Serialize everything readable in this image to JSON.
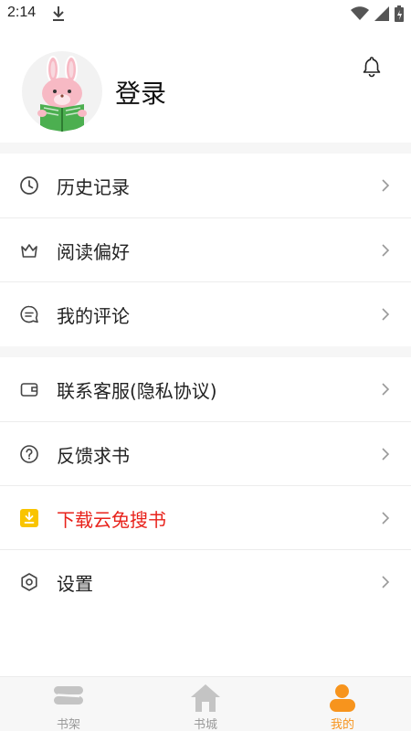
{
  "status_bar": {
    "time": "2:14"
  },
  "profile": {
    "login_label": "登录"
  },
  "menu_group_1": [
    {
      "label": "历史记录",
      "icon": "clock-icon"
    },
    {
      "label": "阅读偏好",
      "icon": "crown-icon"
    },
    {
      "label": "我的评论",
      "icon": "comment-icon"
    }
  ],
  "menu_group_2": [
    {
      "label": "联系客服(隐私协议)",
      "icon": "wallet-icon"
    },
    {
      "label": "反馈求书",
      "icon": "question-icon"
    },
    {
      "label": "下载云兔搜书",
      "icon": "download-icon"
    },
    {
      "label": "设置",
      "icon": "gear-icon"
    }
  ],
  "tabs": [
    {
      "label": "书架",
      "icon": "bookshelf-icon",
      "active": false
    },
    {
      "label": "书城",
      "icon": "home-icon",
      "active": false
    },
    {
      "label": "我的",
      "icon": "person-icon",
      "active": true
    }
  ],
  "colors": {
    "accent": "#f7941d",
    "highlight_red": "#e8221b",
    "download_icon_bg": "#f9c400"
  }
}
